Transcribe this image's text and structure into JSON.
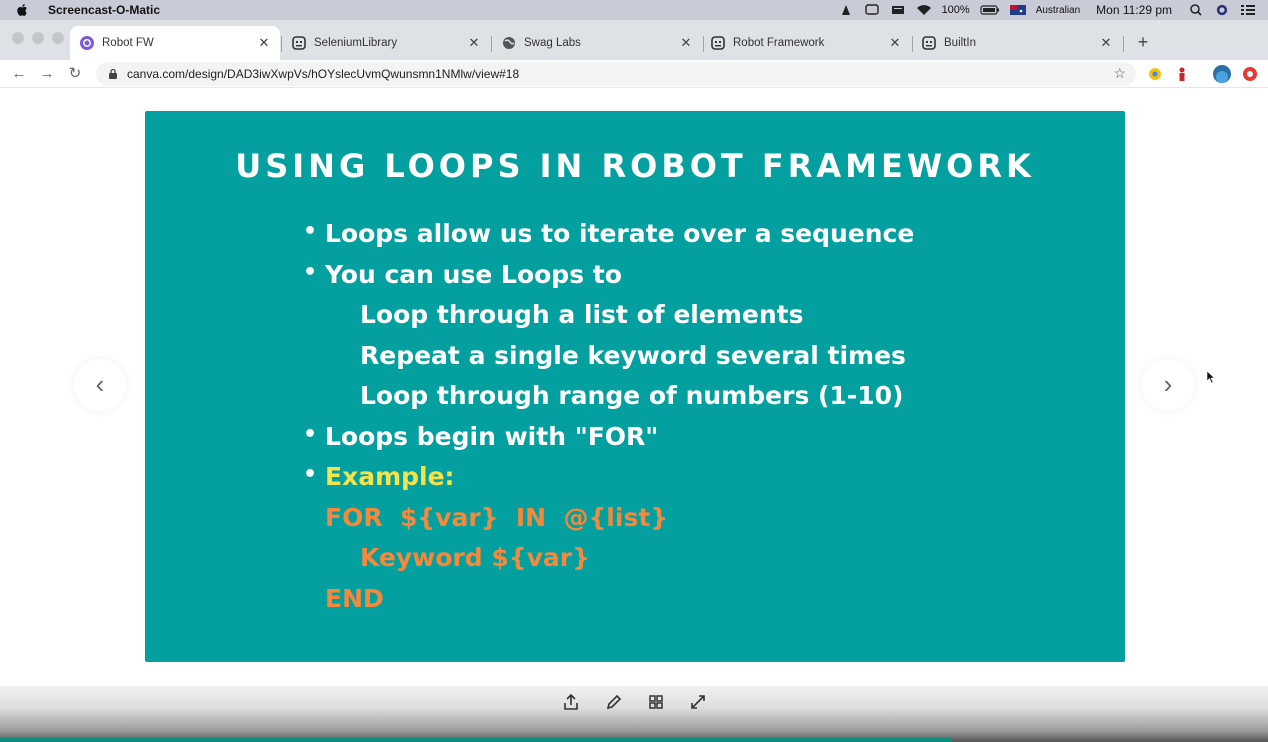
{
  "menubar": {
    "app_name": "Screencast-O-Matic",
    "battery": "100%",
    "input_source": "Australian",
    "clock": "Mon 11:29 pm"
  },
  "tabs": [
    {
      "label": "Robot FW",
      "icon": "canva-icon",
      "active": true
    },
    {
      "label": "SeleniumLibrary",
      "icon": "robot-icon",
      "active": false
    },
    {
      "label": "Swag Labs",
      "icon": "globe-icon",
      "active": false
    },
    {
      "label": "Robot Framework",
      "icon": "robot-icon",
      "active": false
    },
    {
      "label": "BuiltIn",
      "icon": "robot-icon",
      "active": false
    }
  ],
  "toolbar": {
    "url": "canva.com/design/DAD3iwXwpVs/hOYslecUvmQwunsmn1NMlw/view#18"
  },
  "slide": {
    "title": "USING LOOPS IN ROBOT FRAMEWORK",
    "bullets": [
      "Loops allow us to iterate over a sequence",
      "You can use Loops to",
      "Loops begin with \"FOR\"",
      "Example:"
    ],
    "sub_items": [
      "Loop through a list of elements",
      "Repeat a single keyword several times",
      "Loop through range of numbers (1-10)"
    ],
    "code": [
      "FOR  ${var}  IN  @{list}",
      "Keyword ${var}",
      "END"
    ],
    "colors": {
      "background": "#04a09f",
      "text": "#ffffff",
      "example": "#f4e34a",
      "code": "#f5883a"
    }
  }
}
